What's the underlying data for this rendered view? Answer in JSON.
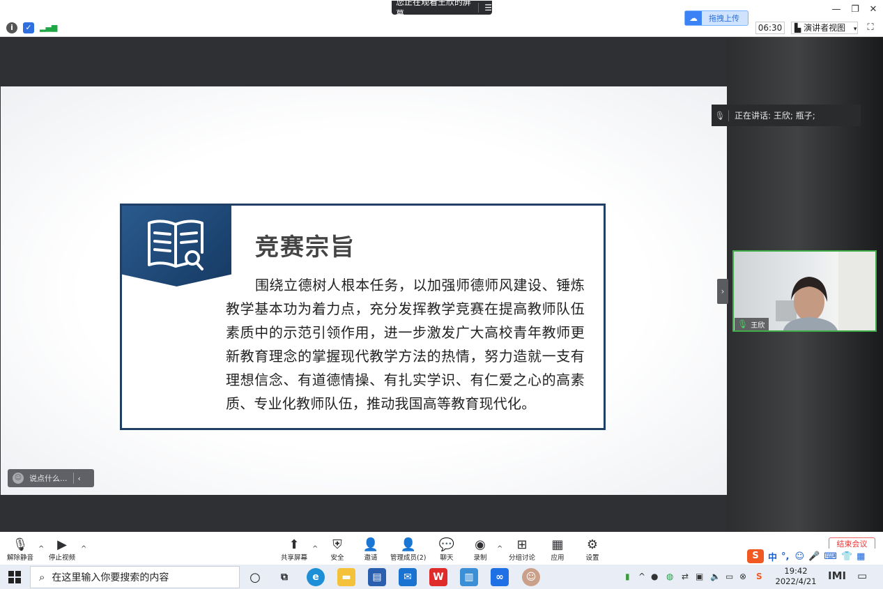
{
  "titlebar": {
    "share_banner": "您正在观看王欣的屏幕",
    "banner_menu_icon": "menu-lines-icon",
    "minimize": "—",
    "restore": "❐",
    "close": "✕"
  },
  "infobar": {
    "info_icon": "info-icon",
    "shield_icon": "shield-icon",
    "signal_icon": "signal-icon",
    "upload_label": "拖拽上传",
    "timer": "06:30",
    "view_mode": "演讲者视图",
    "view_caret": "▾",
    "fullscreen_glyph": "⛶"
  },
  "slide": {
    "title": "竞赛宗旨",
    "body": "围绕立德树人根本任务，以加强师德师风建设、锤炼教学基本功为着力点，充分发挥教学竞赛在提高教师队伍素质中的示范引领作用，进一步激发广大高校青年教师更新教育理念的掌握现代教学方法的热情，努力造就一支有理想信念、有道德情操、有扎实学识、有仁爱之心的高素质、专业化教师队伍，推动我国高等教育现代化。"
  },
  "chat": {
    "placeholder": "说点什么...",
    "collapse": "‹"
  },
  "right_panel": {
    "speaking_label": "正在讲话: 王欣; 瓶子;",
    "toggle": "›",
    "video_name": "王欣"
  },
  "toolbar": {
    "unmute": "解除静音",
    "stop_video": "停止视频",
    "share_screen": "共享屏幕",
    "security": "安全",
    "invite": "邀请",
    "manage_members": "管理成员(2)",
    "chat": "聊天",
    "record": "录制",
    "breakout": "分组讨论",
    "apps": "应用",
    "settings": "设置",
    "end_meeting": "结束会议",
    "caret": "^"
  },
  "ime": {
    "logo": "S",
    "mode": "中",
    "punct": "°,"
  },
  "taskbar": {
    "search_placeholder": "在这里输入你要搜索的内容",
    "time": "19:42",
    "date": "2022/4/21",
    "input_method": "M"
  }
}
